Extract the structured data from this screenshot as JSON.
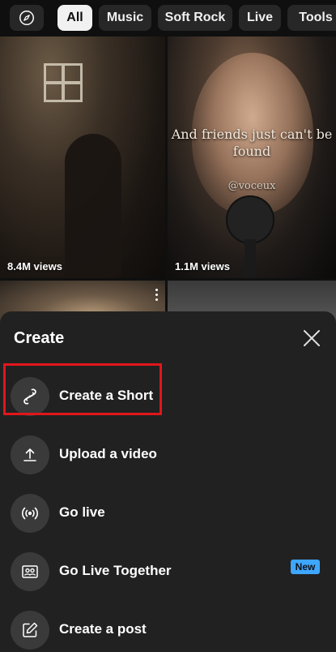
{
  "chips": {
    "explore_icon": "compass-icon",
    "items": [
      {
        "label": "All",
        "active": true
      },
      {
        "label": "Music",
        "active": false
      },
      {
        "label": "Soft Rock",
        "active": false
      },
      {
        "label": "Live",
        "active": false
      },
      {
        "label": "Tools",
        "active": false
      }
    ]
  },
  "shorts": [
    {
      "views": "8.4M views"
    },
    {
      "views": "1.1M views",
      "caption": "And friends just can't be found",
      "handle": "@voceux"
    }
  ],
  "create_sheet": {
    "title": "Create",
    "close_icon": "close-icon",
    "options": [
      {
        "label": "Create a Short",
        "icon": "shorts-icon",
        "highlighted": true
      },
      {
        "label": "Upload a video",
        "icon": "upload-icon"
      },
      {
        "label": "Go live",
        "icon": "live-broadcast-icon"
      },
      {
        "label": "Go Live Together",
        "icon": "people-icon",
        "badge": "New"
      },
      {
        "label": "Create a post",
        "icon": "edit-post-icon"
      }
    ]
  },
  "colors": {
    "background": "#0f0f0f",
    "sheet": "#212121",
    "highlight_border": "#e1161b",
    "new_badge": "#3ea6ff"
  }
}
